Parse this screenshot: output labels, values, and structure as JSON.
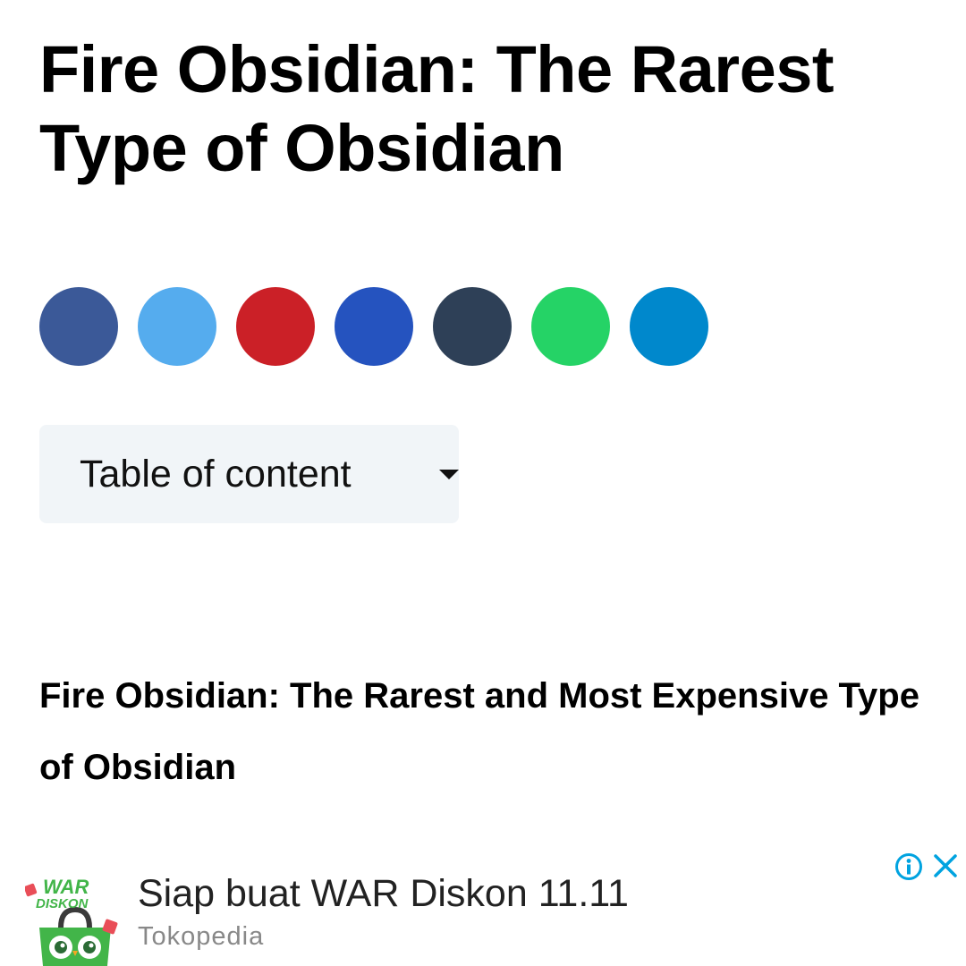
{
  "article": {
    "title": "Fire Obsidian: The Rarest Type of Obsidian",
    "subheading": "Fire Obsidian: The Rarest and Most Expensive Type of Obsidian"
  },
  "share_buttons": [
    {
      "color": "#3b5998"
    },
    {
      "color": "#55acee"
    },
    {
      "color": "#cb2027"
    },
    {
      "color": "#2553bf"
    },
    {
      "color": "#2e4057"
    },
    {
      "color": "#25d366"
    },
    {
      "color": "#0088cc"
    }
  ],
  "toc": {
    "label": "Table of content",
    "icon": "caret-down-icon",
    "background": "#f1f5f8"
  },
  "ad": {
    "headline": "Siap buat WAR Diskon 11.11",
    "advertiser": "Tokopedia",
    "logo_text": [
      "WAR",
      "DISKON"
    ],
    "accent": "#42b549",
    "info_icon": "info-icon",
    "close_icon": "close-icon",
    "control_color": "#00a3e0"
  }
}
